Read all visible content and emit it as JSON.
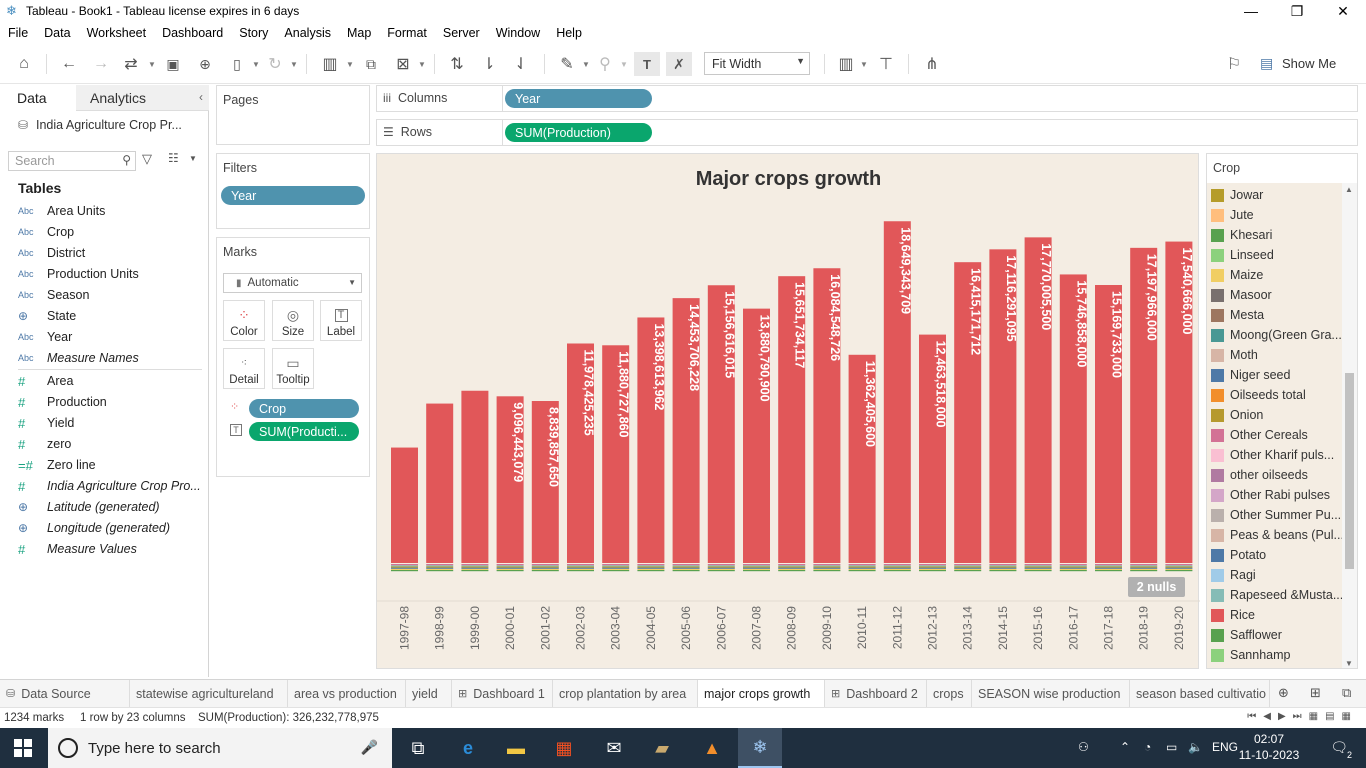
{
  "window": {
    "title": "Tableau - Book1 - Tableau license expires in 6 days",
    "controls": [
      "—",
      "❐",
      "✕"
    ]
  },
  "menu": [
    "File",
    "Data",
    "Worksheet",
    "Dashboard",
    "Story",
    "Analysis",
    "Map",
    "Format",
    "Server",
    "Window",
    "Help"
  ],
  "toolbar": {
    "fit": "Fit Width",
    "show_me": "Show Me"
  },
  "data_pane": {
    "tab_data": "Data",
    "tab_analytics": "Analytics",
    "datasource": "India Agriculture Crop Pr...",
    "search_placeholder": "Search",
    "tables_header": "Tables",
    "fields": [
      {
        "type": "Abc",
        "name": "Area Units",
        "italic": false
      },
      {
        "type": "Abc",
        "name": "Crop",
        "italic": false
      },
      {
        "type": "Abc",
        "name": "District",
        "italic": false
      },
      {
        "type": "Abc",
        "name": "Production Units",
        "italic": false
      },
      {
        "type": "Abc",
        "name": "Season",
        "italic": false
      },
      {
        "type": "globe",
        "name": "State",
        "italic": false
      },
      {
        "type": "Abc",
        "name": "Year",
        "italic": false
      },
      {
        "type": "Abc",
        "name": "Measure Names",
        "italic": true
      },
      {
        "type": "#",
        "name": "Area",
        "italic": false
      },
      {
        "type": "#",
        "name": "Production",
        "italic": false
      },
      {
        "type": "#",
        "name": "Yield",
        "italic": false
      },
      {
        "type": "#",
        "name": "zero",
        "italic": false
      },
      {
        "type": "=#",
        "name": "Zero line",
        "italic": false
      },
      {
        "type": "#",
        "name": "India Agriculture Crop Pro...",
        "italic": true
      },
      {
        "type": "globe",
        "name": "Latitude (generated)",
        "italic": true
      },
      {
        "type": "globe",
        "name": "Longitude (generated)",
        "italic": true
      },
      {
        "type": "#",
        "name": "Measure Values",
        "italic": true
      }
    ]
  },
  "shelves": {
    "pages_label": "Pages",
    "filters_label": "Filters",
    "filter_pill": "Year",
    "marks_label": "Marks",
    "mark_type": "Automatic",
    "mark_buttons": [
      "Color",
      "Size",
      "Label",
      "Detail",
      "Tooltip"
    ],
    "mark_pills": [
      "Crop",
      "SUM(Producti..."
    ],
    "columns_label": "Columns",
    "columns_pill": "Year",
    "rows_label": "Rows",
    "rows_pill": "SUM(Production)"
  },
  "chart_data": {
    "type": "bar",
    "title": "Major crops growth",
    "categories": [
      "1997-98",
      "1998-99",
      "1999-00",
      "2000-01",
      "2001-02",
      "2002-03",
      "2003-04",
      "2004-05",
      "2005-06",
      "2006-07",
      "2007-08",
      "2008-09",
      "2009-10",
      "2010-11",
      "2011-12",
      "2012-13",
      "2013-14",
      "2014-15",
      "2015-16",
      "2016-17",
      "2017-18",
      "2018-19",
      "2019-20"
    ],
    "values": [
      6300000000,
      8700000000,
      9400000000,
      9096443079,
      8839857650,
      11978425235,
      11880727860,
      13398613962,
      14453706228,
      15156616015,
      13880790900,
      15651734117,
      16084548726,
      11362405600,
      18649343709,
      12463518000,
      16415171712,
      17116291095,
      17770005500,
      15746858000,
      15169733000,
      17197966000,
      17540666000
    ],
    "labels": [
      "",
      "",
      "",
      "9,096,443,079",
      "8,839,857,650",
      "11,978,425,235",
      "11,880,727,860",
      "13,398,613,962",
      "14,453,706,228",
      "15,156,616,015",
      "13,880,790,900",
      "15,651,734,117",
      "16,084,548,726",
      "11,362,405,600",
      "18,649,343,709",
      "12,463,518,000",
      "16,415,171,712",
      "17,116,291,095",
      "17,770,005,500",
      "15,746,858,000",
      "15,169,733,000",
      "17,197,966,000",
      "17,540,666,000"
    ],
    "bar_color": "#e15759",
    "nulls_badge": "2 nulls"
  },
  "legend": {
    "title": "Crop",
    "items": [
      {
        "name": "Jowar",
        "color": "#b59c2a"
      },
      {
        "name": "Jute",
        "color": "#ffbe7d"
      },
      {
        "name": "Khesari",
        "color": "#59a14f"
      },
      {
        "name": "Linseed",
        "color": "#8cd17d"
      },
      {
        "name": "Maize",
        "color": "#f1ce63"
      },
      {
        "name": "Masoor",
        "color": "#79706e"
      },
      {
        "name": "Mesta",
        "color": "#9d7660"
      },
      {
        "name": "Moong(Green Gra...",
        "color": "#499894"
      },
      {
        "name": "Moth",
        "color": "#d7b5a6"
      },
      {
        "name": "Niger seed",
        "color": "#4e79a7"
      },
      {
        "name": "Oilseeds total",
        "color": "#f28e2b"
      },
      {
        "name": "Onion",
        "color": "#b6992d"
      },
      {
        "name": "Other Cereals",
        "color": "#d37295"
      },
      {
        "name": "Other Kharif puls...",
        "color": "#fabfd2"
      },
      {
        "name": "other oilseeds",
        "color": "#b07aa1"
      },
      {
        "name": "Other Rabi pulses",
        "color": "#d4a6c8"
      },
      {
        "name": "Other Summer Pu...",
        "color": "#bab0ac"
      },
      {
        "name": "Peas & beans (Pul...",
        "color": "#d7b5a6"
      },
      {
        "name": "Potato",
        "color": "#4e79a7"
      },
      {
        "name": "Ragi",
        "color": "#a0cbe8"
      },
      {
        "name": "Rapeseed &Musta...",
        "color": "#86bcb6"
      },
      {
        "name": "Rice",
        "color": "#e15759"
      },
      {
        "name": "Safflower",
        "color": "#59a14f"
      },
      {
        "name": "Sannhamp",
        "color": "#8cd17d"
      },
      {
        "name": "S...",
        "color": "#b6992d"
      }
    ]
  },
  "sheet_tabs": [
    {
      "label": "Data Source",
      "kind": "ds"
    },
    {
      "label": "statewise agricultureland",
      "kind": "sheet"
    },
    {
      "label": "area vs production",
      "kind": "sheet"
    },
    {
      "label": "yield",
      "kind": "sheet"
    },
    {
      "label": "Dashboard 1",
      "kind": "dash"
    },
    {
      "label": "crop plantation by area",
      "kind": "sheet"
    },
    {
      "label": "major crops growth",
      "kind": "sheet",
      "active": true
    },
    {
      "label": "Dashboard 2",
      "kind": "dash"
    },
    {
      "label": "crops",
      "kind": "sheet"
    },
    {
      "label": "SEASON wise production",
      "kind": "sheet"
    },
    {
      "label": "season based cultivatio",
      "kind": "sheet"
    }
  ],
  "status": {
    "marks": "1234 marks",
    "dims": "1 row by 23 columns",
    "sum": "SUM(Production): 326,232,778,975"
  },
  "taskbar": {
    "search_placeholder": "Type here to search",
    "lang": "ENG",
    "time": "02:07",
    "date": "11-10-2023",
    "notif_count": "2"
  }
}
